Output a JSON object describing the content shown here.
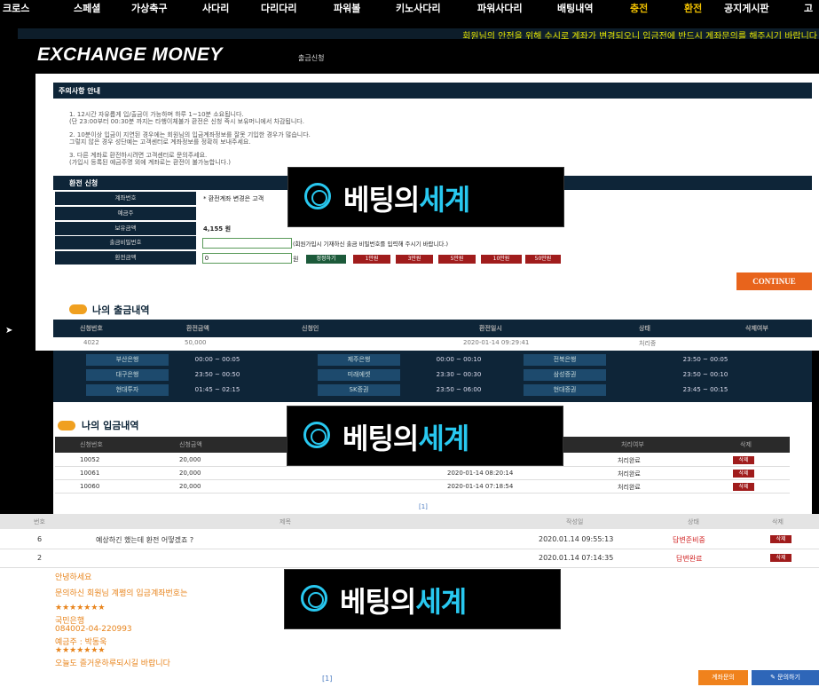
{
  "nav": [
    "크로스",
    "스페셜",
    "가상축구",
    "사다리",
    "다리다리",
    "파워볼",
    "키노사다리",
    "파워사다리",
    "배팅내역",
    "충전",
    "환전",
    "공지게시판",
    "고"
  ],
  "ticker": "회원님의 안전을 위해 수시로 계좌가 변경되오니 입금전에 반드시 계좌문의를 해주시기 바랍니다",
  "page_title": "EXCHANGE MONEY",
  "page_subtitle": "출금신청",
  "notice": {
    "heading": "주의사항 안내",
    "lines": [
      "1. 12시간 자유롭게 입/출금이 가능하며 하루 1~10분 소요됩니다.",
      "(단 23:00부터 00:30분 까지는 타행이체불가 환전은 신청 즉시 보유머니에서 차감됩니다.",
      "2. 10분이상 입금이 지연된 경우에는 회원님의 입금계좌정보를 잘못 기입한 경우가 많습니다.",
      "그렇지 않은 경우 성단예는 고객센터로 계좌정보를 정확히 보내주세요.",
      "3. 다른 계좌로 환전하시려면 고객센터로 문의주세요.",
      "(가입시 등록된 예금주명 외에 계좌로는 환전이 불가능합니다.)"
    ]
  },
  "form": {
    "heading": "환전 신청",
    "labels": [
      "계좌번호",
      "예금주",
      "보유금액",
      "출금비밀번호",
      "환전금액"
    ],
    "account_note": "* 환전계좌 변경은 고객",
    "balance": "4,155 원",
    "password_hint": "(회원가입시 기재하신 출금 비밀번호를 입력해 주시기 바랍니다.)",
    "amount_value": "0",
    "amount_unit": "원",
    "reset_label": "정정하기",
    "quick_amounts": [
      "1만원",
      "3만원",
      "5만원",
      "10만원",
      "50만원"
    ],
    "continue_label": "CONTINUE"
  },
  "withdraw_history": {
    "title": "나의 출금내역",
    "headers": [
      "신청번호",
      "환전금액",
      "신청인",
      "환전일시",
      "상태",
      "삭제여부"
    ],
    "row": {
      "id": "4022",
      "amount": "50,000",
      "datetime": "2020-01-14 09:29:41",
      "status": "처리중"
    }
  },
  "bank_hours": [
    {
      "bank": "부산은행",
      "time": "00:00 ~ 00:05"
    },
    {
      "bank": "제주은행",
      "time": "00:00 ~ 00:10"
    },
    {
      "bank": "전북은행",
      "time": "23:50 ~ 00:05"
    },
    {
      "bank": "대구은행",
      "time": "23:50 ~ 00:50"
    },
    {
      "bank": "미래에셋",
      "time": "23:30 ~ 00:30"
    },
    {
      "bank": "삼성증권",
      "time": "23:50 ~ 00:10"
    },
    {
      "bank": "현대투자",
      "time": "01:45 ~ 02:15"
    },
    {
      "bank": "SK증권",
      "time": "23:50 ~ 06:00"
    },
    {
      "bank": "현대증권",
      "time": "23:45 ~ 00:15"
    }
  ],
  "deposit_history": {
    "title": "나의 입금내역",
    "headers": [
      "신청번호",
      "신청금액",
      "처리여부",
      "삭제"
    ],
    "rows": [
      {
        "id": "10052",
        "amount": "20,000",
        "datetime": "",
        "status": "처리완료",
        "del": "삭제"
      },
      {
        "id": "10061",
        "amount": "20,000",
        "datetime": "2020-01-14 08:20:14",
        "status": "처리완료",
        "del": "삭제"
      },
      {
        "id": "10060",
        "amount": "20,000",
        "datetime": "2020-01-14 07:18:54",
        "status": "처리완료",
        "del": "삭제"
      }
    ],
    "pager": "[1]"
  },
  "qa": {
    "headers": [
      "번호",
      "제목",
      "작성일",
      "상태",
      "삭제"
    ],
    "rows": [
      {
        "num": "6",
        "title": "예상하긴 했는데 환전 어떻겠죠 ?",
        "date": "2020.01.14 09:55:13",
        "status": "답변준비중",
        "del": "삭제"
      },
      {
        "num": "2",
        "title": "",
        "date": "2020.01.14 07:14:35",
        "status": "답변완료",
        "del": "삭제"
      }
    ],
    "reply_lines": [
      "안녕하세요",
      "문의하신 회원님 계쩡의 입금계좌번호는",
      "★★★★★★★",
      "국민은행",
      "084002-04-220993",
      "예금주 : 박동욱",
      "★★★★★★★",
      "오늘도 즐거운하루되시길 바랍니다"
    ],
    "pager": "[1]",
    "ask_label": "계좌문의",
    "write_label": "문의하기"
  },
  "watermark": {
    "text_white": "베팅의",
    "text_blue": "세계"
  },
  "colors": {
    "navy": "#0e2538",
    "red": "#a01c1c",
    "orange": "#e8641c",
    "accent_blue": "#28c8f0"
  }
}
